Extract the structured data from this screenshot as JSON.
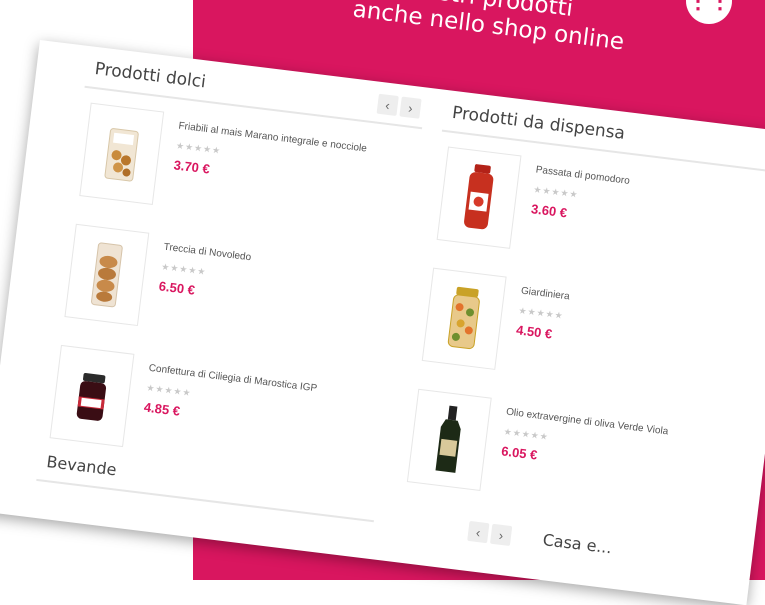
{
  "banner": {
    "line1": "nostri prodotti",
    "line2": "anche nello shop online",
    "cart_icon": "cart-icon"
  },
  "sections": {
    "dolci": {
      "title": "Prodotti dolci",
      "products": [
        {
          "name": "Friabili al mais Marano integrale e nocciole",
          "stars": "★★★★★",
          "price": "3.70 €",
          "image": "cookie-bag-icon"
        },
        {
          "name": "Treccia di Novoledo",
          "stars": "★★★★★",
          "price": "6.50 €",
          "image": "bread-bag-icon"
        },
        {
          "name": "Confettura di Ciliegia di Marostica IGP",
          "stars": "★★★★★",
          "price": "4.85 €",
          "image": "jam-jar-icon"
        }
      ]
    },
    "dispensa": {
      "title": "Prodotti da dispensa",
      "products": [
        {
          "name": "Passata di pomodoro",
          "stars": "★★★★★",
          "price": "3.60 €",
          "image": "tomato-jar-icon"
        },
        {
          "name": "Giardiniera",
          "stars": "★★★★★",
          "price": "4.50 €",
          "image": "pickles-jar-icon"
        },
        {
          "name": "Olio extravergine di oliva Verde Viola",
          "stars": "★★★★★",
          "price": "6.05 €",
          "image": "oil-bottle-icon"
        }
      ]
    },
    "bevande": {
      "title": "Bevande"
    },
    "casa": {
      "title": "Casa e..."
    }
  },
  "nav": {
    "prev": "‹",
    "next": "›"
  },
  "colors": {
    "accent": "#d9165f",
    "stars": "#c9c9c9"
  }
}
